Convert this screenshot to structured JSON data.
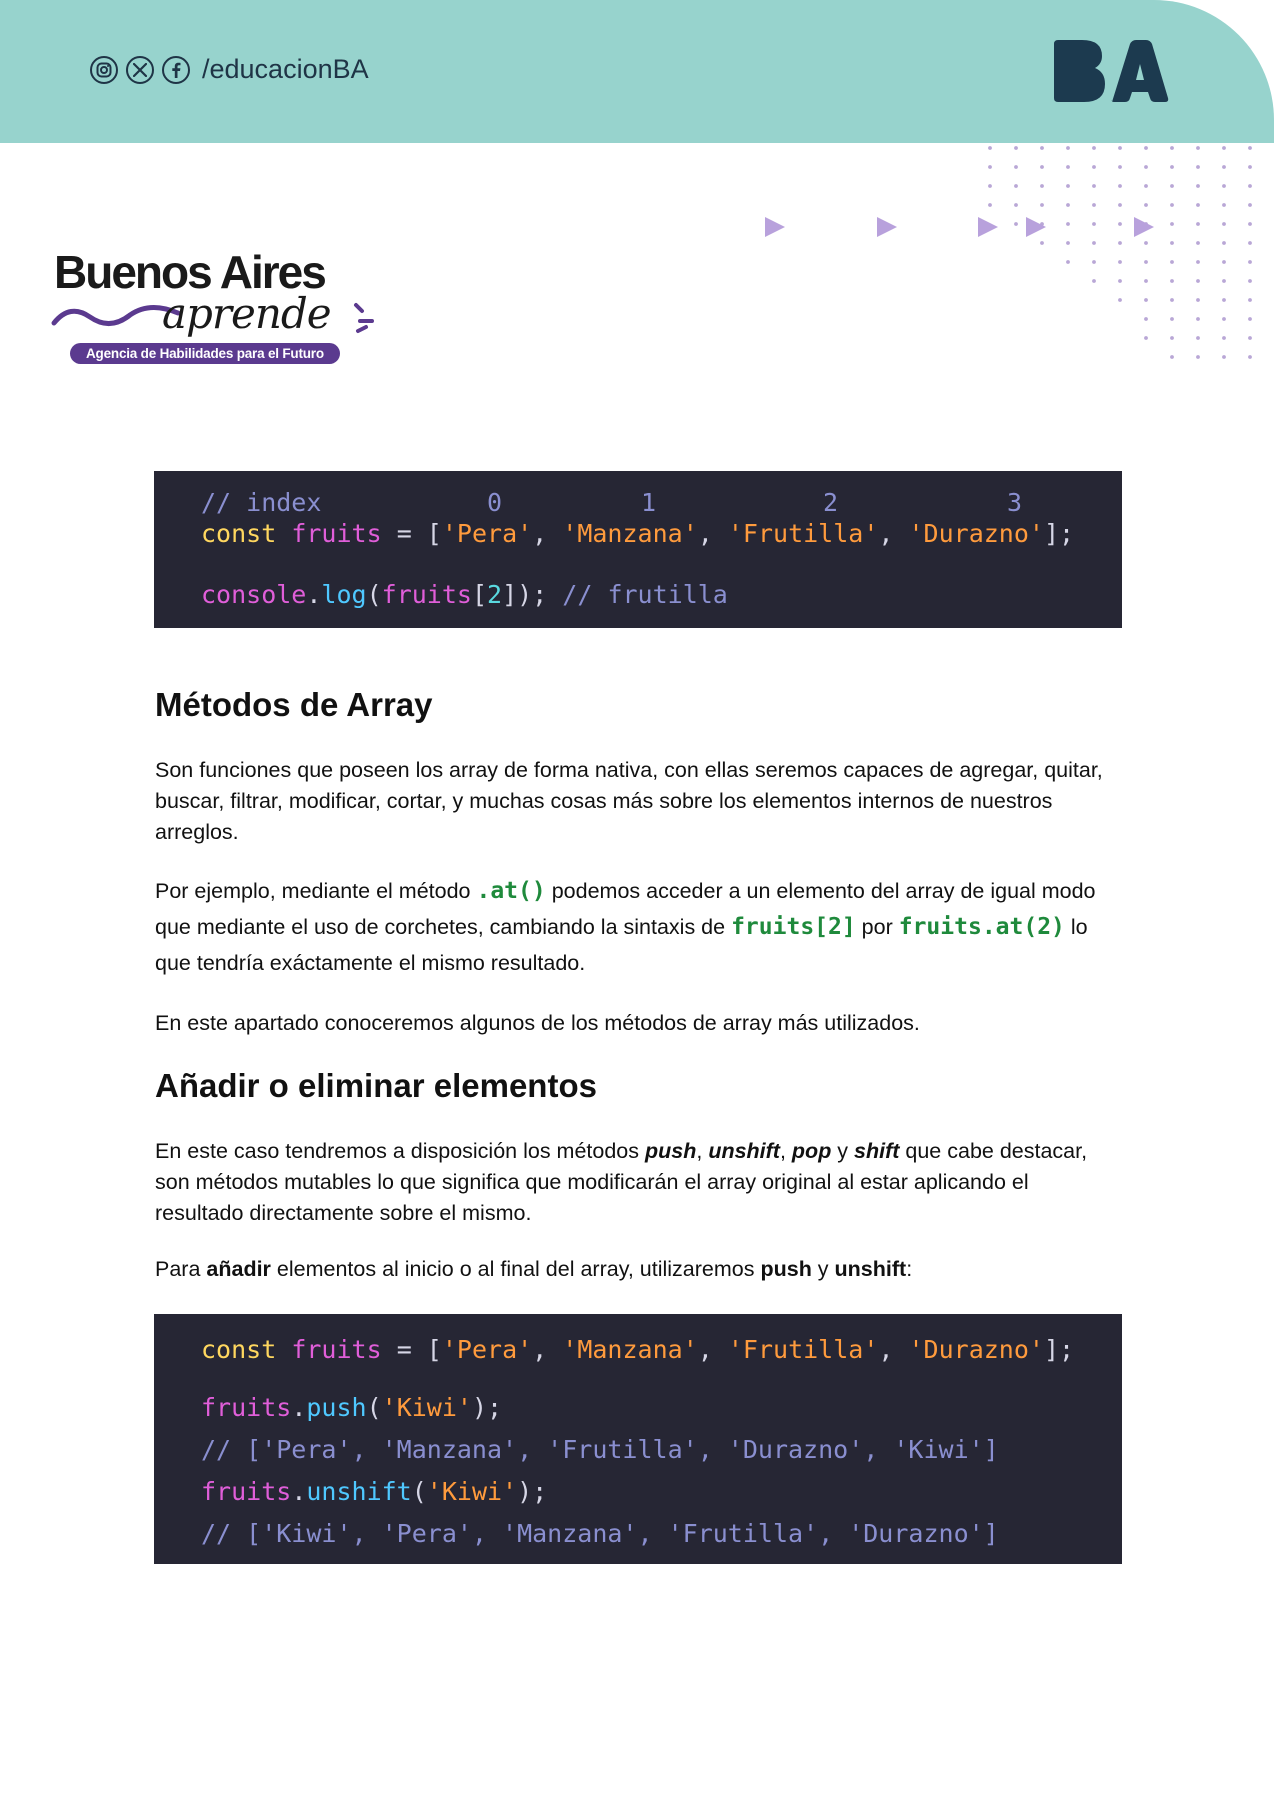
{
  "header": {
    "handle": "/educacionBA",
    "social_icons": [
      "instagram-icon",
      "x-icon",
      "facebook-icon"
    ],
    "logo": "BA",
    "bg_color": "#97d3cd"
  },
  "brand": {
    "title": "Buenos Aires",
    "subtitle": "aprende",
    "tagline": "Agencia de Habilidades para el Futuro",
    "accent": "#5b3a8f"
  },
  "code_block_1": {
    "comment_index": "// index",
    "indices": [
      "0",
      "1",
      "2",
      "3"
    ],
    "kw_const": "const",
    "var_fruits": "fruits",
    "eq_open": " = [",
    "s_pera": "'Pera'",
    "s_manzana": "'Manzana'",
    "s_frutilla": "'Frutilla'",
    "s_durazno": "'Durazno'",
    "sep": ", ",
    "close": "];",
    "console": "console",
    "dot": ".",
    "log": "log",
    "paren_open": "(",
    "bracket_open": "[",
    "idx": "2",
    "end": "]);",
    "comment_result": " // frutilla"
  },
  "section1": {
    "heading": "Métodos de Array",
    "p1": "Son funciones que poseen los array de forma nativa, con ellas seremos capaces de agregar, quitar, buscar, filtrar, modificar, cortar, y muchas cosas más sobre los elementos internos de nuestros arreglos.",
    "p2_a": "Por ejemplo, mediante el método ",
    "p2_code1": ".at()",
    "p2_b": " podemos acceder a un elemento del array de igual modo que mediante el uso de corchetes, cambiando la sintaxis de ",
    "p2_code2": "fruits[2]",
    "p2_c": " por ",
    "p2_code3": "fruits.at(2)",
    "p2_d": " lo que tendría exáctamente el mismo resultado.",
    "p3": "En este apartado conoceremos algunos de los métodos de array más utilizados."
  },
  "section2": {
    "heading": "Añadir o eliminar elementos",
    "p1_a": "En este caso tendremos a disposición los métodos ",
    "m_push": "push",
    "comma1": ", ",
    "m_unshift": "unshift",
    "comma2": ", ",
    "m_pop": "pop",
    "y1": " y ",
    "m_shift": "shift",
    "p1_b": " que cabe destacar, son métodos mutables lo que significa que modificarán el array original al estar aplicando el resultado directamente sobre el mismo.",
    "p2_a": "Para ",
    "p2_add": "añadir",
    "p2_b": " elementos al inicio o al final del array, utilizaremos ",
    "p2_push": "push",
    "p2_y": " y ",
    "p2_unshift": "unshift",
    "p2_colon": ":"
  },
  "code_block_2": {
    "kw_const": "const",
    "var_fruits": "fruits",
    "eq_open": " = [",
    "s_pera": "'Pera'",
    "s_manzana": "'Manzana'",
    "s_frutilla": "'Frutilla'",
    "s_durazno": "'Durazno'",
    "sep": ", ",
    "close": "];",
    "fruits": "fruits",
    "dot": ".",
    "push": "push",
    "unshift": "unshift",
    "paren_open": "(",
    "s_kiwi": "'Kiwi'",
    "paren_close": ");",
    "comment_after_push": "// ['Pera', 'Manzana', 'Frutilla', 'Durazno', 'Kiwi']",
    "comment_after_unshift": "// ['Kiwi', 'Pera', 'Manzana', 'Frutilla', 'Durazno']"
  }
}
